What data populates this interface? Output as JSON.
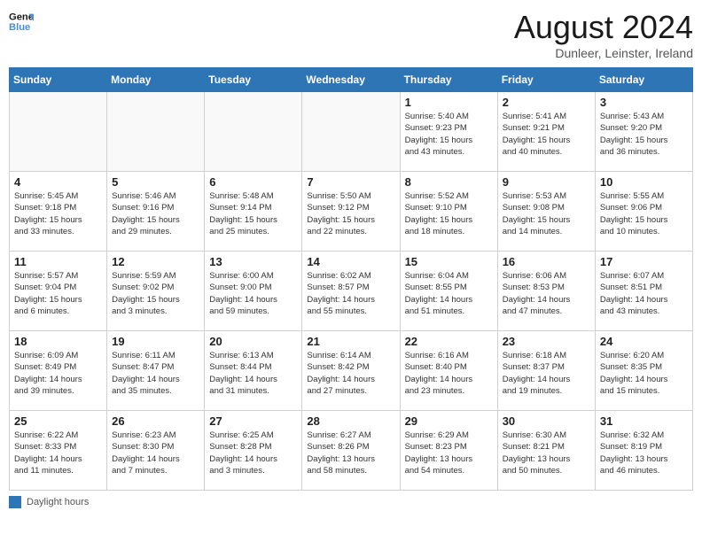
{
  "header": {
    "logo_line1": "General",
    "logo_line2": "Blue",
    "month_year": "August 2024",
    "location": "Dunleer, Leinster, Ireland"
  },
  "days_of_week": [
    "Sunday",
    "Monday",
    "Tuesday",
    "Wednesday",
    "Thursday",
    "Friday",
    "Saturday"
  ],
  "weeks": [
    [
      {
        "day": "",
        "info": ""
      },
      {
        "day": "",
        "info": ""
      },
      {
        "day": "",
        "info": ""
      },
      {
        "day": "",
        "info": ""
      },
      {
        "day": "1",
        "info": "Sunrise: 5:40 AM\nSunset: 9:23 PM\nDaylight: 15 hours\nand 43 minutes."
      },
      {
        "day": "2",
        "info": "Sunrise: 5:41 AM\nSunset: 9:21 PM\nDaylight: 15 hours\nand 40 minutes."
      },
      {
        "day": "3",
        "info": "Sunrise: 5:43 AM\nSunset: 9:20 PM\nDaylight: 15 hours\nand 36 minutes."
      }
    ],
    [
      {
        "day": "4",
        "info": "Sunrise: 5:45 AM\nSunset: 9:18 PM\nDaylight: 15 hours\nand 33 minutes."
      },
      {
        "day": "5",
        "info": "Sunrise: 5:46 AM\nSunset: 9:16 PM\nDaylight: 15 hours\nand 29 minutes."
      },
      {
        "day": "6",
        "info": "Sunrise: 5:48 AM\nSunset: 9:14 PM\nDaylight: 15 hours\nand 25 minutes."
      },
      {
        "day": "7",
        "info": "Sunrise: 5:50 AM\nSunset: 9:12 PM\nDaylight: 15 hours\nand 22 minutes."
      },
      {
        "day": "8",
        "info": "Sunrise: 5:52 AM\nSunset: 9:10 PM\nDaylight: 15 hours\nand 18 minutes."
      },
      {
        "day": "9",
        "info": "Sunrise: 5:53 AM\nSunset: 9:08 PM\nDaylight: 15 hours\nand 14 minutes."
      },
      {
        "day": "10",
        "info": "Sunrise: 5:55 AM\nSunset: 9:06 PM\nDaylight: 15 hours\nand 10 minutes."
      }
    ],
    [
      {
        "day": "11",
        "info": "Sunrise: 5:57 AM\nSunset: 9:04 PM\nDaylight: 15 hours\nand 6 minutes."
      },
      {
        "day": "12",
        "info": "Sunrise: 5:59 AM\nSunset: 9:02 PM\nDaylight: 15 hours\nand 3 minutes."
      },
      {
        "day": "13",
        "info": "Sunrise: 6:00 AM\nSunset: 9:00 PM\nDaylight: 14 hours\nand 59 minutes."
      },
      {
        "day": "14",
        "info": "Sunrise: 6:02 AM\nSunset: 8:57 PM\nDaylight: 14 hours\nand 55 minutes."
      },
      {
        "day": "15",
        "info": "Sunrise: 6:04 AM\nSunset: 8:55 PM\nDaylight: 14 hours\nand 51 minutes."
      },
      {
        "day": "16",
        "info": "Sunrise: 6:06 AM\nSunset: 8:53 PM\nDaylight: 14 hours\nand 47 minutes."
      },
      {
        "day": "17",
        "info": "Sunrise: 6:07 AM\nSunset: 8:51 PM\nDaylight: 14 hours\nand 43 minutes."
      }
    ],
    [
      {
        "day": "18",
        "info": "Sunrise: 6:09 AM\nSunset: 8:49 PM\nDaylight: 14 hours\nand 39 minutes."
      },
      {
        "day": "19",
        "info": "Sunrise: 6:11 AM\nSunset: 8:47 PM\nDaylight: 14 hours\nand 35 minutes."
      },
      {
        "day": "20",
        "info": "Sunrise: 6:13 AM\nSunset: 8:44 PM\nDaylight: 14 hours\nand 31 minutes."
      },
      {
        "day": "21",
        "info": "Sunrise: 6:14 AM\nSunset: 8:42 PM\nDaylight: 14 hours\nand 27 minutes."
      },
      {
        "day": "22",
        "info": "Sunrise: 6:16 AM\nSunset: 8:40 PM\nDaylight: 14 hours\nand 23 minutes."
      },
      {
        "day": "23",
        "info": "Sunrise: 6:18 AM\nSunset: 8:37 PM\nDaylight: 14 hours\nand 19 minutes."
      },
      {
        "day": "24",
        "info": "Sunrise: 6:20 AM\nSunset: 8:35 PM\nDaylight: 14 hours\nand 15 minutes."
      }
    ],
    [
      {
        "day": "25",
        "info": "Sunrise: 6:22 AM\nSunset: 8:33 PM\nDaylight: 14 hours\nand 11 minutes."
      },
      {
        "day": "26",
        "info": "Sunrise: 6:23 AM\nSunset: 8:30 PM\nDaylight: 14 hours\nand 7 minutes."
      },
      {
        "day": "27",
        "info": "Sunrise: 6:25 AM\nSunset: 8:28 PM\nDaylight: 14 hours\nand 3 minutes."
      },
      {
        "day": "28",
        "info": "Sunrise: 6:27 AM\nSunset: 8:26 PM\nDaylight: 13 hours\nand 58 minutes."
      },
      {
        "day": "29",
        "info": "Sunrise: 6:29 AM\nSunset: 8:23 PM\nDaylight: 13 hours\nand 54 minutes."
      },
      {
        "day": "30",
        "info": "Sunrise: 6:30 AM\nSunset: 8:21 PM\nDaylight: 13 hours\nand 50 minutes."
      },
      {
        "day": "31",
        "info": "Sunrise: 6:32 AM\nSunset: 8:19 PM\nDaylight: 13 hours\nand 46 minutes."
      }
    ]
  ],
  "footer": {
    "daylight_label": "Daylight hours"
  }
}
